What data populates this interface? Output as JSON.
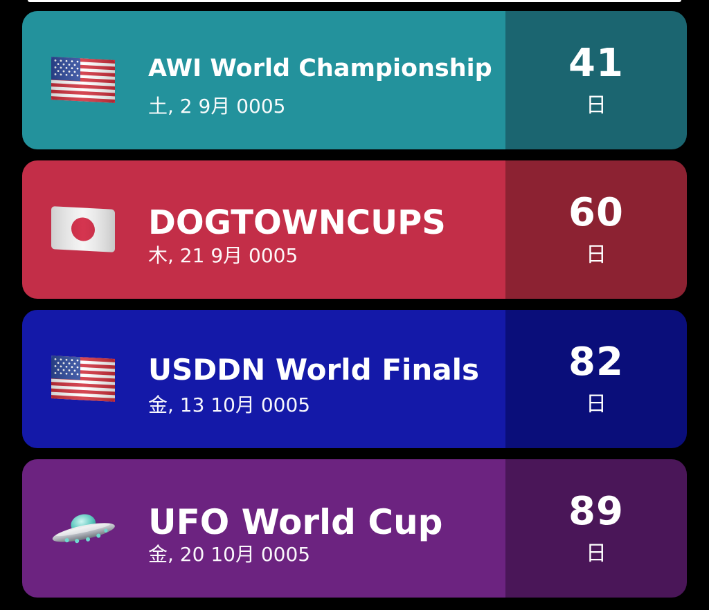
{
  "events": [
    {
      "flag_icon": "us-flag-icon",
      "title": "AWI World Championship",
      "date": "土, 2 9月 0005",
      "days": "41",
      "unit": "日",
      "color_main": "#23929C",
      "color_count": "#1B6570"
    },
    {
      "flag_icon": "japan-flag-icon",
      "title": "DOGTOWNCUPS",
      "date": "木, 21 9月 0005",
      "days": "60",
      "unit": "日",
      "color_main": "#C32E48",
      "color_count": "#8C2232"
    },
    {
      "flag_icon": "us-flag-icon",
      "title": "USDDN World Finals",
      "date": "金, 13 10月 0005",
      "days": "82",
      "unit": "日",
      "color_main": "#1419A8",
      "color_count": "#0A0E7A"
    },
    {
      "flag_icon": "ufo-icon",
      "title": "UFO World Cup",
      "date": "金, 20 10月 0005",
      "days": "89",
      "unit": "日",
      "color_main": "#6C2380",
      "color_count": "#4A1658"
    }
  ]
}
